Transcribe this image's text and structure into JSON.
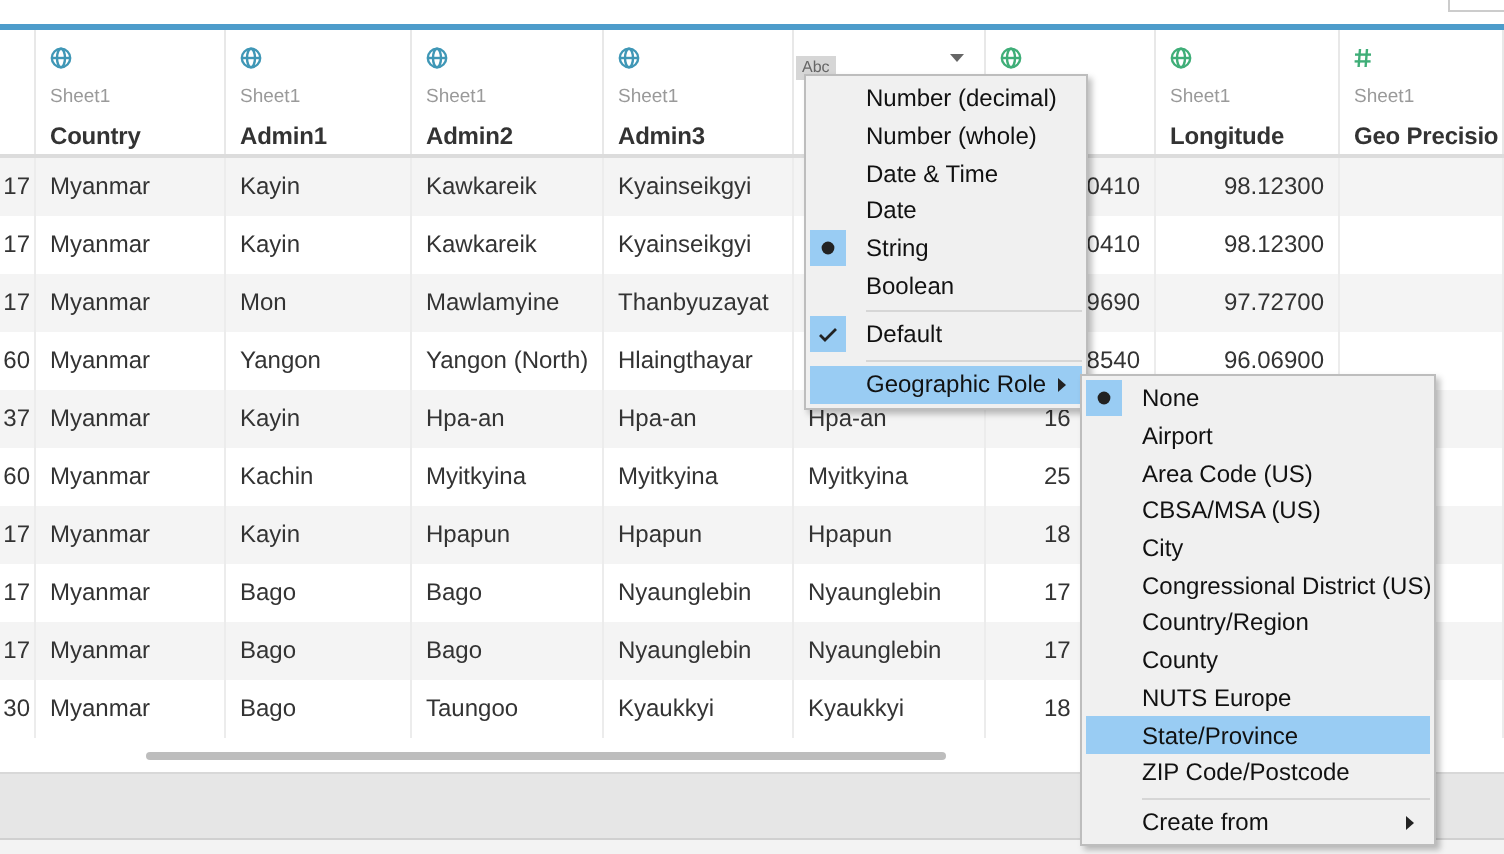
{
  "columns": [
    {
      "kind": "blank"
    },
    {
      "kind": "geo-string",
      "source": "Sheet1",
      "name": "Country"
    },
    {
      "kind": "geo-string",
      "source": "Sheet1",
      "name": "Admin1"
    },
    {
      "kind": "geo-string",
      "source": "Sheet1",
      "name": "Admin2"
    },
    {
      "kind": "geo-string",
      "source": "Sheet1",
      "name": "Admin3"
    },
    {
      "kind": "string",
      "badge": "Abc"
    },
    {
      "kind": "geo-number"
    },
    {
      "kind": "geo-number",
      "source": "Sheet1",
      "name": "Longitude"
    },
    {
      "kind": "number",
      "source": "Sheet1",
      "name": "Geo Precisio"
    }
  ],
  "rows": [
    [
      "17",
      "Myanmar",
      "Kayin",
      "Kawkareik",
      "Kyainseikgyi",
      null,
      "0410",
      "98.12300",
      null
    ],
    [
      "17",
      "Myanmar",
      "Kayin",
      "Kawkareik",
      "Kyainseikgyi",
      null,
      "0410",
      "98.12300",
      null
    ],
    [
      "17",
      "Myanmar",
      "Mon",
      "Mawlamyine",
      "Thanbyuzayat",
      null,
      "9690",
      "97.72700",
      null
    ],
    [
      "60",
      "Myanmar",
      "Yangon",
      "Yangon (North)",
      "Hlaingthayar",
      null,
      "8540",
      "96.06900",
      null
    ],
    [
      "37",
      "Myanmar",
      "Kayin",
      "Hpa-an",
      "Hpa-an",
      "Hpa-an",
      "16",
      null,
      null
    ],
    [
      "60",
      "Myanmar",
      "Kachin",
      "Myitkyina",
      "Myitkyina",
      "Myitkyina",
      "25",
      null,
      null
    ],
    [
      "17",
      "Myanmar",
      "Kayin",
      "Hpapun",
      "Hpapun",
      "Hpapun",
      "18",
      null,
      null
    ],
    [
      "17",
      "Myanmar",
      "Bago",
      "Bago",
      "Nyaunglebin",
      "Nyaunglebin",
      "17",
      null,
      null
    ],
    [
      "17",
      "Myanmar",
      "Bago",
      "Bago",
      "Nyaunglebin",
      "Nyaunglebin",
      "17",
      null,
      null
    ],
    [
      "30",
      "Myanmar",
      "Bago",
      "Taungoo",
      "Kyaukkyi",
      "Kyaukkyi",
      "18",
      null,
      null
    ]
  ],
  "menu": {
    "items": [
      {
        "kind": "radio",
        "label": "Number (decimal)",
        "selected": false,
        "highlighted": false
      },
      {
        "kind": "radio",
        "label": "Number (whole)",
        "selected": false,
        "highlighted": false
      },
      {
        "kind": "radio",
        "label": "Date & Time",
        "selected": false,
        "highlighted": false
      },
      {
        "kind": "radio",
        "label": "Date",
        "selected": false,
        "highlighted": false
      },
      {
        "kind": "radio",
        "label": "String",
        "selected": true,
        "highlighted": false
      },
      {
        "kind": "radio",
        "label": "Boolean",
        "selected": false,
        "highlighted": false
      },
      {
        "kind": "separator"
      },
      {
        "kind": "check",
        "label": "Default",
        "checked": true,
        "highlighted": false
      },
      {
        "kind": "separator"
      },
      {
        "kind": "submenu",
        "label": "Geographic Role",
        "highlighted": true
      }
    ]
  },
  "submenu": {
    "items": [
      {
        "kind": "radio",
        "label": "None",
        "selected": true,
        "highlighted": false
      },
      {
        "kind": "radio",
        "label": "Airport",
        "selected": false,
        "highlighted": false
      },
      {
        "kind": "radio",
        "label": "Area Code (US)",
        "selected": false,
        "highlighted": false
      },
      {
        "kind": "radio",
        "label": "CBSA/MSA (US)",
        "selected": false,
        "highlighted": false
      },
      {
        "kind": "radio",
        "label": "City",
        "selected": false,
        "highlighted": false
      },
      {
        "kind": "radio",
        "label": "Congressional District (US)",
        "selected": false,
        "highlighted": false
      },
      {
        "kind": "radio",
        "label": "Country/Region",
        "selected": false,
        "highlighted": false
      },
      {
        "kind": "radio",
        "label": "County",
        "selected": false,
        "highlighted": false
      },
      {
        "kind": "radio",
        "label": "NUTS Europe",
        "selected": false,
        "highlighted": false
      },
      {
        "kind": "radio",
        "label": "State/Province",
        "selected": false,
        "highlighted": true
      },
      {
        "kind": "radio",
        "label": "ZIP Code/Postcode",
        "selected": false,
        "highlighted": false
      },
      {
        "kind": "separator"
      },
      {
        "kind": "submenu",
        "label": "Create from",
        "highlighted": false
      }
    ]
  }
}
